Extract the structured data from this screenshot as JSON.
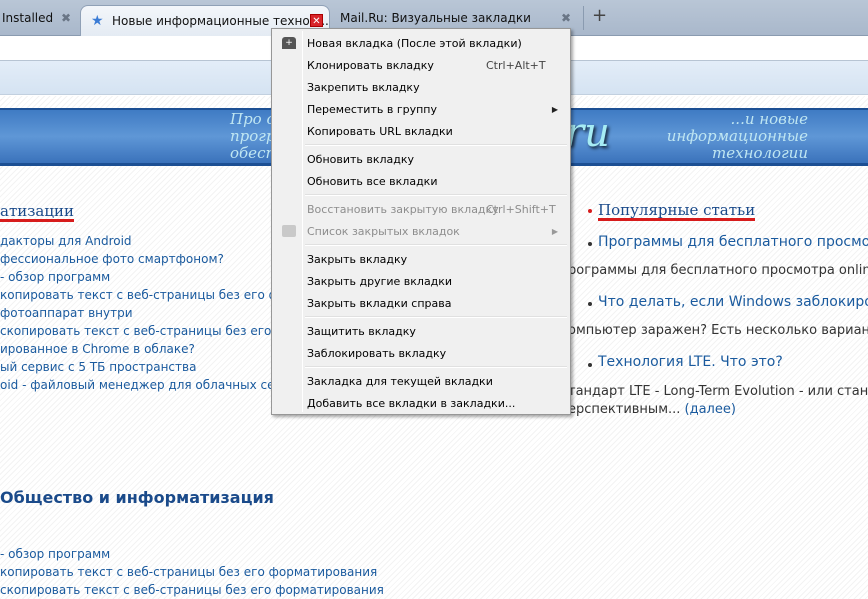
{
  "tabs": [
    {
      "label": "Installed",
      "active": false
    },
    {
      "label": "Новые информационные технол...",
      "active": true
    },
    {
      "label": "Mail.Ru: Визуальные закладки",
      "active": false
    }
  ],
  "new_tab_symbol": "+",
  "banner": {
    "left_lines": [
      "Про с",
      "прогр",
      "обесп"
    ],
    "logo": "ru",
    "right_lines": [
      "...и новые",
      "информационные",
      "технологии"
    ]
  },
  "left_column": {
    "heading": "атизации",
    "links": [
      "дакторы для Android",
      "фессиональное фото смартфоном?",
      "- обзор программ",
      "копировать текст с веб-страницы без его форма",
      "фотоаппарат внутри",
      "скопировать текст с веб-страницы без его форм",
      "ированное в Chrome в облаке?",
      "ый сервис с 5 ТБ пространства",
      "oid - файловый менеджер для облачных сервис"
    ]
  },
  "right_column": {
    "heading": "Популярные статьи",
    "items": [
      {
        "title": "Программы для бесплатного просмотра о",
        "desc": [
          "рограммы для бесплатного просмотра online tv"
        ]
      },
      {
        "title": "Что делать, если Windows заблокирован",
        "desc": [
          "омпьютер заражен? Есть несколько вариантов"
        ]
      },
      {
        "title": "Технология LTE. Что это?",
        "desc": [
          "тандарт LTE - Long-Term Evolution - или станда"
        ],
        "more_prefix": "ерспективным... ",
        "more": "(далее)"
      }
    ]
  },
  "section2": {
    "heading": "Общество и информатизация",
    "links": [
      "- обзор программ",
      "копировать текст с веб-страницы без его форматирования",
      "скопировать текст с веб-страницы без его форматирования"
    ]
  },
  "context_menu": {
    "items": [
      {
        "label": "Новая вкладка  (После этой вкладки)",
        "icon": "new-tab-icon"
      },
      {
        "label": "Клонировать вкладку",
        "shortcut": "Ctrl+Alt+T"
      },
      {
        "label": "Закрепить вкладку"
      },
      {
        "label": "Переместить в группу",
        "submenu": true
      },
      {
        "label": "Копировать URL вкладки"
      },
      {
        "label": "Обновить вкладку"
      },
      {
        "label": "Обновить все вкладки"
      },
      {
        "label": "Восстановить закрытую вкладку",
        "shortcut": "Ctrl+Shift+T",
        "disabled": true
      },
      {
        "label": "Список закрытых вкладок",
        "submenu": true,
        "disabled": true,
        "icon": "closed-tabs-icon"
      },
      {
        "label": "Закрыть вкладку"
      },
      {
        "label": "Закрыть другие вкладки"
      },
      {
        "label": "Закрыть вкладки справа"
      },
      {
        "label": "Защитить вкладку"
      },
      {
        "label": "Заблокировать вкладку"
      },
      {
        "label": "Закладка для текущей вкладки"
      },
      {
        "label": "Добавить все вкладки в закладки..."
      }
    ]
  },
  "colors": {
    "link": "#1a5a9e",
    "banner": "#4f89cf",
    "accent_underline": "#d71c1c"
  }
}
